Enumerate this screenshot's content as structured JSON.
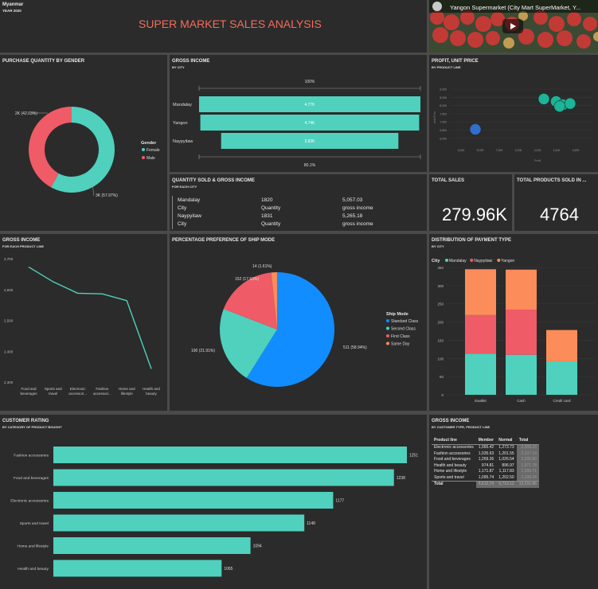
{
  "header": {
    "country": "Myanmar",
    "year": "YEAR 2020",
    "title": "SUPER MARKET SALES ANALYSIS"
  },
  "video": {
    "title": "Yangon Supermarket (City Mart SuperMarket, Y..."
  },
  "gender": {
    "title": "PURCHASE QUANTITY BY GENDER",
    "legend_title": "Gender",
    "slices": [
      {
        "name": "Female",
        "label": "3K (57.97%)",
        "percent": 57.97,
        "color": "#4fd1be"
      },
      {
        "name": "Male",
        "label": "2K (42.03%)",
        "percent": 42.03,
        "color": "#ef5b67"
      }
    ]
  },
  "funnel": {
    "title": "GROSS INCOME",
    "subtitle": "BY CITY",
    "top_label": "100%",
    "bottom_label": "80.1%",
    "color": "#4fd1be",
    "rows": [
      {
        "city": "Mandalay",
        "value": 5057.03,
        "label": "4.77K"
      },
      {
        "city": "Yangon",
        "value": 4999.0,
        "label": "4.74K"
      },
      {
        "city": "Naypyitaw",
        "value": 4050.0,
        "label": "3.82K"
      }
    ]
  },
  "scatter": {
    "title": "PROFIT, UNIT PRICE",
    "subtitle": "BY PRODUCT LINE",
    "xlabel": "Profit",
    "ylabel": "Unit Price",
    "y_ticks": [
      "9,000",
      "8,500",
      "8,000",
      "7,500",
      "7,000",
      "6,500",
      "6,000"
    ],
    "x_ticks": [
      "3,000",
      "5,000",
      "7,000",
      "2,000",
      "2,200",
      "2,400",
      "2,600"
    ]
  },
  "quantity": {
    "title": "QUANTITY SOLD & GROSS INCOME",
    "subtitle": "FOR EACH CITY",
    "rows": [
      [
        "Mandalay",
        "1820",
        "5,057.03"
      ],
      [
        "City",
        "Quantity",
        "gross income"
      ],
      [
        "Naypyitaw",
        "1831",
        "5,265.18"
      ],
      [
        "City",
        "Quantity",
        "gross income"
      ]
    ]
  },
  "total_sales": {
    "title": "TOTAL SALES",
    "value": "279.96K"
  },
  "total_products": {
    "title": "TOTAL PRODUCTS SOLD IN ...",
    "value": "4764"
  },
  "chart_data": [
    {
      "type": "line",
      "title": "GROSS INCOME",
      "subtitle": "FOR EACH PRODUCT LINE",
      "categories": [
        "Food and beverages",
        "Sports and travel",
        "Electronic accessori...",
        "Fashion accessori...",
        "Home and lifestyle",
        "Health and beauty"
      ],
      "values": [
        2673,
        2625,
        2588,
        2586,
        2564,
        2343
      ],
      "ylim": [
        2300,
        2700
      ],
      "yticks": [
        2300,
        2400,
        2500,
        2600,
        2700
      ],
      "ytick_labels": [
        "2,300",
        "2,400",
        "2,500",
        "2,600",
        "2,700"
      ],
      "color": "#4fd1be"
    },
    {
      "type": "pie",
      "title": "PERCENTAGE PREFERENCE OF SHIP MODE",
      "legend_title": "Ship Mode",
      "slices": [
        {
          "name": "Standard Class",
          "value": 511,
          "percent": 58.94,
          "label": "511 (58.94%)",
          "color": "#118dff"
        },
        {
          "name": "Second Class",
          "value": 190,
          "percent": 21.91,
          "label": "190 (21.91%)",
          "color": "#4fd1be"
        },
        {
          "name": "First Class",
          "value": 152,
          "percent": 17.53,
          "label": "152 (17.53%)",
          "color": "#ef5b67"
        },
        {
          "name": "Same Day",
          "value": 14,
          "percent": 1.61,
          "label": "14 (1.61%)",
          "color": "#fc8c5a"
        }
      ]
    },
    {
      "type": "bar",
      "title": "DISTRIBUTION OF PAYMENT TYPE",
      "subtitle": "BY CITY",
      "legend_title": "City",
      "categories": [
        "Ewallet",
        "Cash",
        "Credit card"
      ],
      "series": [
        {
          "name": "Mandalay",
          "values": [
            113,
            110,
            92
          ],
          "color": "#4fd1be"
        },
        {
          "name": "Naypyitaw",
          "values": [
            106,
            124,
            0
          ],
          "color": "#ef5b67"
        },
        {
          "name": "Yangon",
          "values": [
            126,
            110,
            86
          ],
          "color": "#fc8c5a"
        }
      ],
      "ylim": [
        0,
        350
      ],
      "yticks": [
        0,
        50,
        100,
        150,
        200,
        250,
        300,
        350
      ]
    },
    {
      "type": "bar",
      "orientation": "horizontal",
      "title": "CUSTOMER RATING",
      "subtitle": "BY CATEGORY OF PRODUCT BOUGHT",
      "categories": [
        "Fashion accessories",
        "Food and beverages",
        "Electronic accessories",
        "Sports and travel",
        "Home and lifestyle",
        "Health and beauty"
      ],
      "values": [
        1251,
        1238,
        1177,
        1148,
        1094,
        1065
      ],
      "color": "#4fd1be"
    },
    {
      "type": "scatter",
      "title": "PROFIT, UNIT PRICE",
      "subtitle": "BY PRODUCT LINE",
      "points": [
        {
          "x": 2450,
          "y": 8400,
          "color": "#1bb597"
        },
        {
          "x": 2520,
          "y": 8250,
          "color": "#1bb597"
        },
        {
          "x": 2560,
          "y": 8050,
          "color": "#1bb597"
        },
        {
          "x": 2600,
          "y": 8120,
          "color": "#1bb597"
        },
        {
          "x": 2540,
          "y": 7950,
          "color": "#1bb597"
        },
        {
          "x": 3300,
          "y": 6550,
          "color": "#2f6fce"
        }
      ]
    },
    {
      "type": "table",
      "title": "GROSS INCOME",
      "subtitle": "BY CUSTOMER TYPE, PRODUCT LINE",
      "columns": [
        "Product line",
        "Member",
        "Normal",
        "Total"
      ],
      "rows": [
        [
          "Electronic accessories",
          "1,065.42",
          "1,273.73",
          "2,339.15"
        ],
        [
          "Fashion accessories",
          "1,035.63",
          "1,201.55",
          "2,237.19"
        ],
        [
          "Food and beverages",
          "1,269.26",
          "1,026.54",
          "2,295.80"
        ],
        [
          "Health and beauty",
          "974.81",
          "896.97",
          "1,871.78"
        ],
        [
          "Home and lifestyle",
          "1,171.87",
          "1,117.83",
          "2,289.71"
        ],
        [
          "Sports and travel",
          "1,095.74",
          "1,202.50",
          "2,298.24"
        ]
      ],
      "total": [
        "Total",
        "6,612.74",
        "6,719.12",
        "13,331.86"
      ]
    }
  ]
}
